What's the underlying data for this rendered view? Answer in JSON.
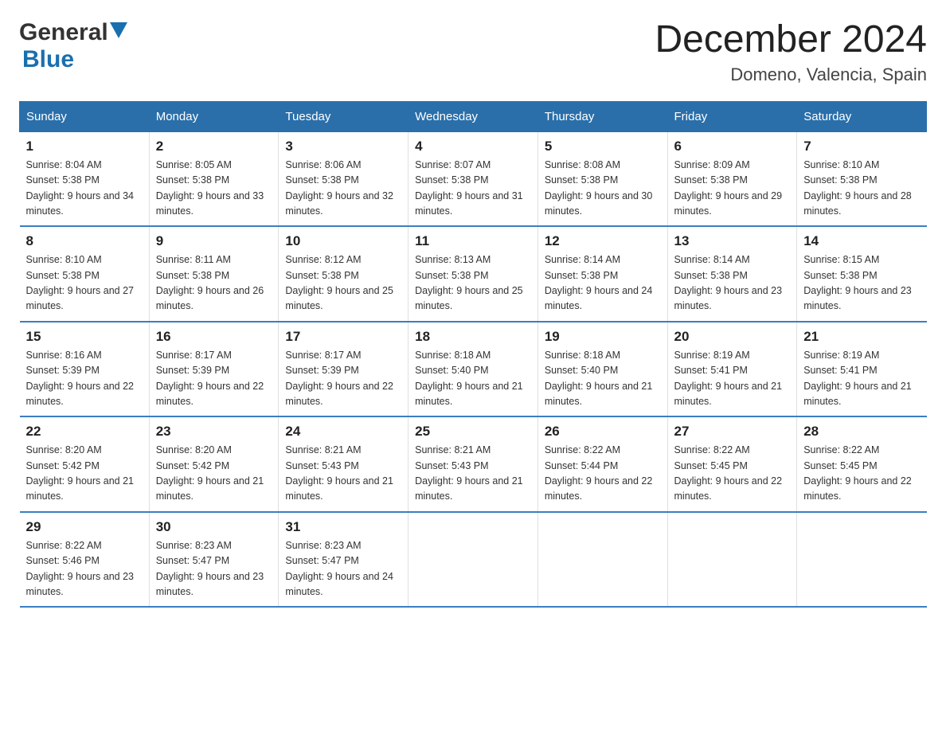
{
  "header": {
    "title": "December 2024",
    "location": "Domeno, Valencia, Spain",
    "logo_general": "General",
    "logo_blue": "Blue"
  },
  "days_of_week": [
    "Sunday",
    "Monday",
    "Tuesday",
    "Wednesday",
    "Thursday",
    "Friday",
    "Saturday"
  ],
  "weeks": [
    [
      {
        "day": "1",
        "sunrise": "8:04 AM",
        "sunset": "5:38 PM",
        "daylight": "9 hours and 34 minutes."
      },
      {
        "day": "2",
        "sunrise": "8:05 AM",
        "sunset": "5:38 PM",
        "daylight": "9 hours and 33 minutes."
      },
      {
        "day": "3",
        "sunrise": "8:06 AM",
        "sunset": "5:38 PM",
        "daylight": "9 hours and 32 minutes."
      },
      {
        "day": "4",
        "sunrise": "8:07 AM",
        "sunset": "5:38 PM",
        "daylight": "9 hours and 31 minutes."
      },
      {
        "day": "5",
        "sunrise": "8:08 AM",
        "sunset": "5:38 PM",
        "daylight": "9 hours and 30 minutes."
      },
      {
        "day": "6",
        "sunrise": "8:09 AM",
        "sunset": "5:38 PM",
        "daylight": "9 hours and 29 minutes."
      },
      {
        "day": "7",
        "sunrise": "8:10 AM",
        "sunset": "5:38 PM",
        "daylight": "9 hours and 28 minutes."
      }
    ],
    [
      {
        "day": "8",
        "sunrise": "8:10 AM",
        "sunset": "5:38 PM",
        "daylight": "9 hours and 27 minutes."
      },
      {
        "day": "9",
        "sunrise": "8:11 AM",
        "sunset": "5:38 PM",
        "daylight": "9 hours and 26 minutes."
      },
      {
        "day": "10",
        "sunrise": "8:12 AM",
        "sunset": "5:38 PM",
        "daylight": "9 hours and 25 minutes."
      },
      {
        "day": "11",
        "sunrise": "8:13 AM",
        "sunset": "5:38 PM",
        "daylight": "9 hours and 25 minutes."
      },
      {
        "day": "12",
        "sunrise": "8:14 AM",
        "sunset": "5:38 PM",
        "daylight": "9 hours and 24 minutes."
      },
      {
        "day": "13",
        "sunrise": "8:14 AM",
        "sunset": "5:38 PM",
        "daylight": "9 hours and 23 minutes."
      },
      {
        "day": "14",
        "sunrise": "8:15 AM",
        "sunset": "5:38 PM",
        "daylight": "9 hours and 23 minutes."
      }
    ],
    [
      {
        "day": "15",
        "sunrise": "8:16 AM",
        "sunset": "5:39 PM",
        "daylight": "9 hours and 22 minutes."
      },
      {
        "day": "16",
        "sunrise": "8:17 AM",
        "sunset": "5:39 PM",
        "daylight": "9 hours and 22 minutes."
      },
      {
        "day": "17",
        "sunrise": "8:17 AM",
        "sunset": "5:39 PM",
        "daylight": "9 hours and 22 minutes."
      },
      {
        "day": "18",
        "sunrise": "8:18 AM",
        "sunset": "5:40 PM",
        "daylight": "9 hours and 21 minutes."
      },
      {
        "day": "19",
        "sunrise": "8:18 AM",
        "sunset": "5:40 PM",
        "daylight": "9 hours and 21 minutes."
      },
      {
        "day": "20",
        "sunrise": "8:19 AM",
        "sunset": "5:41 PM",
        "daylight": "9 hours and 21 minutes."
      },
      {
        "day": "21",
        "sunrise": "8:19 AM",
        "sunset": "5:41 PM",
        "daylight": "9 hours and 21 minutes."
      }
    ],
    [
      {
        "day": "22",
        "sunrise": "8:20 AM",
        "sunset": "5:42 PM",
        "daylight": "9 hours and 21 minutes."
      },
      {
        "day": "23",
        "sunrise": "8:20 AM",
        "sunset": "5:42 PM",
        "daylight": "9 hours and 21 minutes."
      },
      {
        "day": "24",
        "sunrise": "8:21 AM",
        "sunset": "5:43 PM",
        "daylight": "9 hours and 21 minutes."
      },
      {
        "day": "25",
        "sunrise": "8:21 AM",
        "sunset": "5:43 PM",
        "daylight": "9 hours and 21 minutes."
      },
      {
        "day": "26",
        "sunrise": "8:22 AM",
        "sunset": "5:44 PM",
        "daylight": "9 hours and 22 minutes."
      },
      {
        "day": "27",
        "sunrise": "8:22 AM",
        "sunset": "5:45 PM",
        "daylight": "9 hours and 22 minutes."
      },
      {
        "day": "28",
        "sunrise": "8:22 AM",
        "sunset": "5:45 PM",
        "daylight": "9 hours and 22 minutes."
      }
    ],
    [
      {
        "day": "29",
        "sunrise": "8:22 AM",
        "sunset": "5:46 PM",
        "daylight": "9 hours and 23 minutes."
      },
      {
        "day": "30",
        "sunrise": "8:23 AM",
        "sunset": "5:47 PM",
        "daylight": "9 hours and 23 minutes."
      },
      {
        "day": "31",
        "sunrise": "8:23 AM",
        "sunset": "5:47 PM",
        "daylight": "9 hours and 24 minutes."
      },
      null,
      null,
      null,
      null
    ]
  ]
}
